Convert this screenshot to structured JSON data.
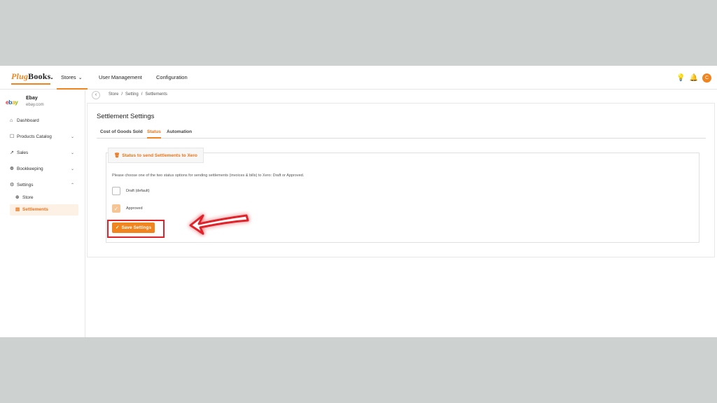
{
  "nav": {
    "logo_prefix": "Plug",
    "logo_suffix": "Books",
    "items": [
      {
        "label": "Stores"
      },
      {
        "label": "User Management"
      },
      {
        "label": "Configuration"
      }
    ],
    "avatar_initial": "C"
  },
  "sidebar": {
    "store_name": "Ebay",
    "store_domain": "ebay.com",
    "items": [
      {
        "label": "Dashboard",
        "icon": "home-icon"
      },
      {
        "label": "Products Catalog",
        "icon": "box-icon"
      },
      {
        "label": "Sales",
        "icon": "chart-icon"
      },
      {
        "label": "Bookkeeping",
        "icon": "gear-cog-icon"
      },
      {
        "label": "Settings",
        "icon": "settings-icon"
      }
    ],
    "subitems": [
      {
        "label": "Store"
      },
      {
        "label": "Settlements"
      }
    ]
  },
  "breadcrumb": [
    "Store",
    "Setting",
    "Settlements"
  ],
  "page": {
    "title": "Settlement Settings",
    "tabs": [
      {
        "label": "Cost of Goods Sold"
      },
      {
        "label": "Status"
      },
      {
        "label": "Automation"
      }
    ],
    "active_tab": "Status",
    "section_title": "Status to send Settlements to Xero",
    "description": "Please choose one of the two status options for sending settlements (invoices & bills) to Xero: Draft or Approved.",
    "options": [
      {
        "label": "Draft (default)",
        "checked": false
      },
      {
        "label": "Approved",
        "checked": true
      }
    ],
    "save_label": "Save Settings"
  },
  "colors": {
    "accent": "#f0841e",
    "highlight": "#e0232a"
  }
}
